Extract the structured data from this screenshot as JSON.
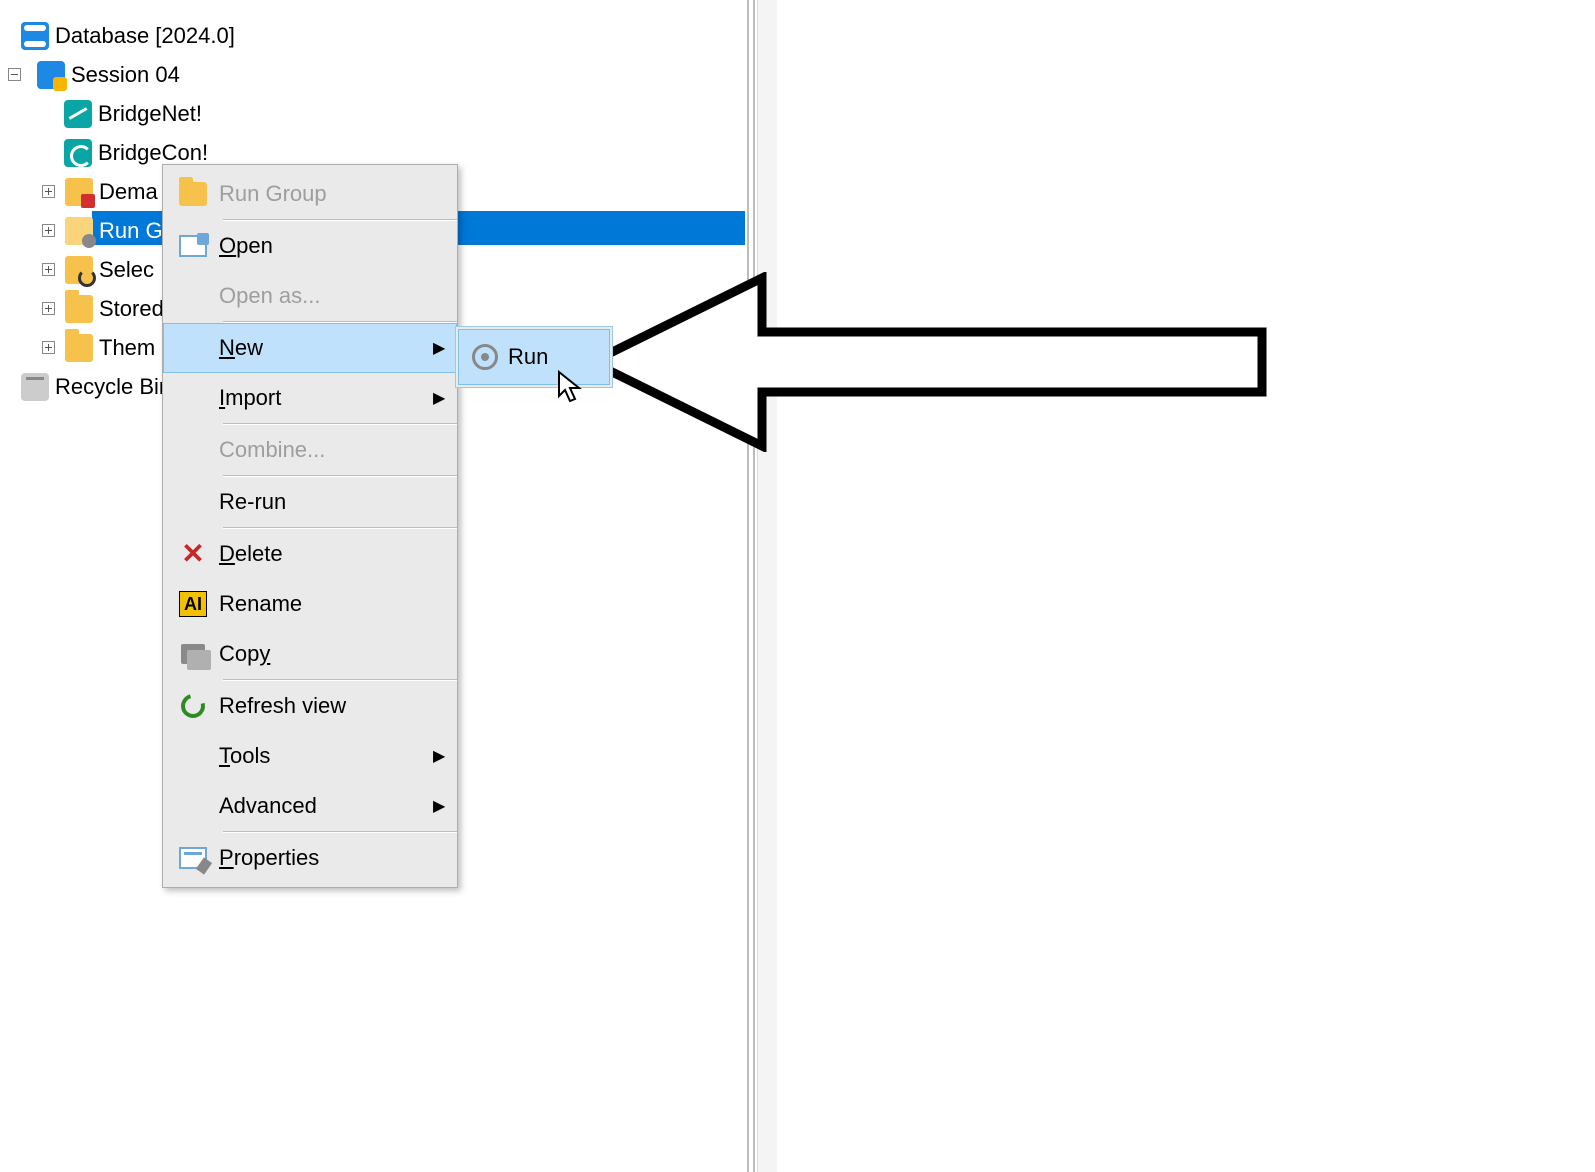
{
  "tree": {
    "root_label": "Database [2024.0]",
    "session_label": "Session 04",
    "bridgenet_label": "BridgeNet!",
    "bridgecon_label": "BridgeCon!",
    "demand_label_visible": "Dema",
    "rungroup_label_visible": "Run G",
    "selections_label_visible": "Selec",
    "stored_label_visible": "Stored",
    "themes_label_visible": "Them",
    "recycle_label": "Recycle Bin"
  },
  "context_menu": {
    "run_group": "Run Group",
    "open": "Open",
    "open_as": "Open as...",
    "new": "New",
    "import": "Import",
    "combine": "Combine...",
    "rerun": "Re-run",
    "delete": "Delete",
    "rename": "Rename",
    "copy": "Copy",
    "refresh": "Refresh view",
    "tools": "Tools",
    "advanced": "Advanced",
    "properties": "Properties"
  },
  "submenu": {
    "run": "Run"
  }
}
